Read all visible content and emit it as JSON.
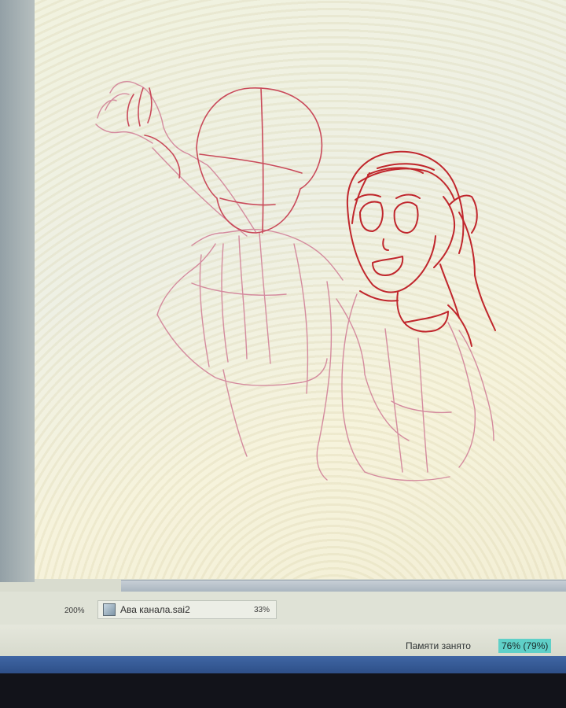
{
  "canvas": {
    "zoom_left": "200%"
  },
  "tab": {
    "filename": "Ава канала.sai2",
    "zoom": "33%",
    "icon": "image-file-icon"
  },
  "status": {
    "memory_label": "Памяти занято",
    "memory_value": "76% (79%)",
    "accent": "#5fd0c8"
  },
  "colors": {
    "sketch_dark": "#c0262c",
    "sketch_light": "#d48b9e"
  }
}
